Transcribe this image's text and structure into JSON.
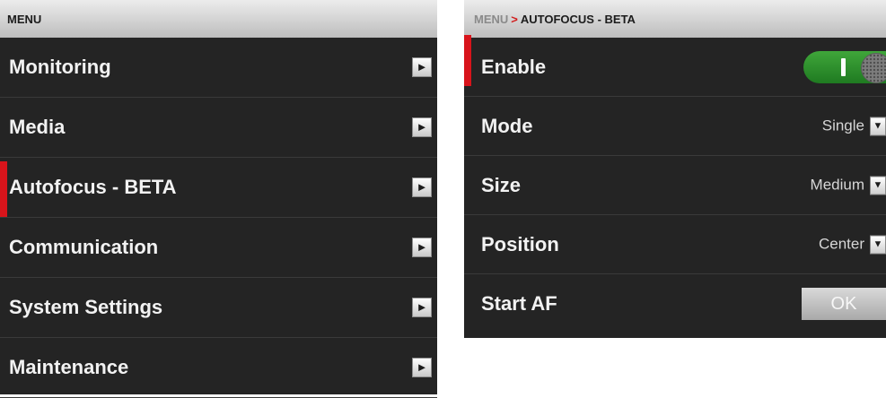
{
  "left_menu": {
    "header": "MENU",
    "items": [
      {
        "label": "Monitoring",
        "arrow": "►",
        "selected": false
      },
      {
        "label": "Media",
        "arrow": "►",
        "selected": false
      },
      {
        "label": "Autofocus - BETA",
        "arrow": "►",
        "selected": true
      },
      {
        "label": "Communication",
        "arrow": "►",
        "selected": false
      },
      {
        "label": "System Settings",
        "arrow": "►",
        "selected": false
      },
      {
        "label": "Maintenance",
        "arrow": "►",
        "selected": false
      }
    ]
  },
  "autofocus": {
    "breadcrumb": {
      "root": "MENU",
      "separator": ">",
      "current": "AUTOFOCUS - BETA"
    },
    "enable": {
      "label": "Enable",
      "toggle_state": "on"
    },
    "mode": {
      "label": "Mode",
      "value": "Single",
      "arrow": "▼"
    },
    "size": {
      "label": "Size",
      "value": "Medium",
      "arrow": "▼"
    },
    "position": {
      "label": "Position",
      "value": "Center",
      "arrow": "▼"
    },
    "start_af": {
      "label": "Start AF",
      "button": "OK"
    }
  },
  "colors": {
    "panel_bg": "#242424",
    "selection_marker": "#d8141b",
    "toggle_on": "#2e8f2e",
    "breadcrumb_separator": "#d21a1a"
  },
  "icons": {
    "menu_arrow": "chevron-right-icon",
    "dropdown_arrow": "chevron-down-icon"
  }
}
